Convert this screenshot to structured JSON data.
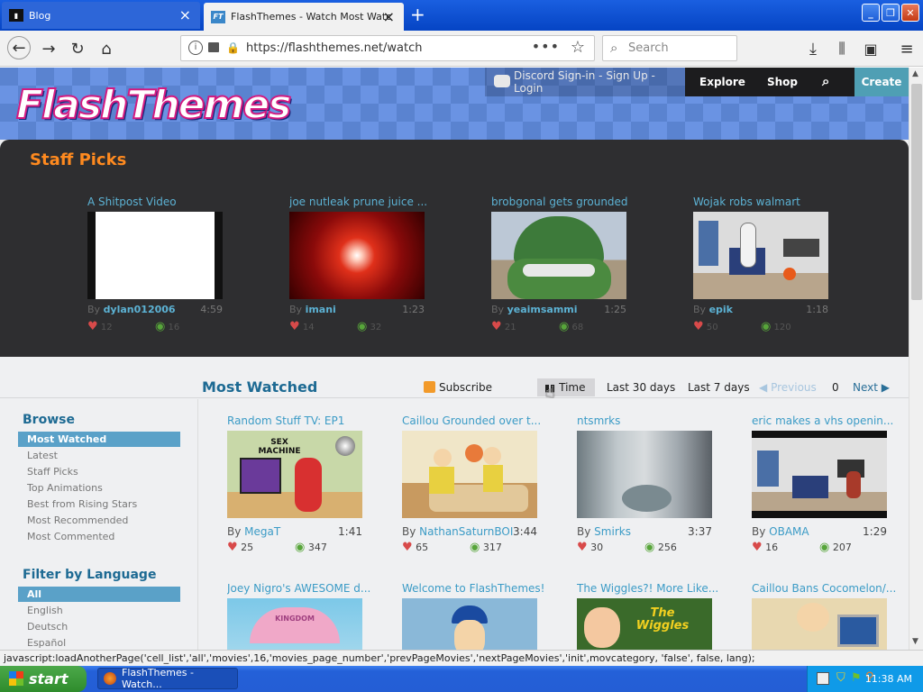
{
  "browser": {
    "tabs": [
      {
        "label": "Blog",
        "favicon": "blog-favicon"
      },
      {
        "label": "FlashThemes - Watch Most Watc",
        "favicon": "flashthemes-favicon"
      }
    ],
    "url": "https://flashthemes.net/watch",
    "search_placeholder": "Search"
  },
  "site": {
    "logo": "FlashThemes",
    "signin": "Discord Sign-in - Sign Up - Login",
    "nav": {
      "explore": "Explore",
      "shop": "Shop",
      "create": "Create"
    }
  },
  "staff_picks": {
    "title": "Staff Picks",
    "items": [
      {
        "title": "A Shitpost Video",
        "by": "By",
        "author": "dylan012006",
        "duration": "4:59",
        "likes": "12",
        "views": "16"
      },
      {
        "title": "joe nutleak prune juice ...",
        "by": "By",
        "author": "imani",
        "duration": "1:23",
        "likes": "14",
        "views": "32"
      },
      {
        "title": "brobgonal gets grounded",
        "by": "By",
        "author": "yeaimsammi",
        "duration": "1:25",
        "likes": "21",
        "views": "68"
      },
      {
        "title": "Wojak robs walmart",
        "by": "By",
        "author": "epik",
        "duration": "1:18",
        "likes": "50",
        "views": "120"
      }
    ]
  },
  "most_watched": {
    "title": "Most Watched",
    "subscribe": "Subscribe",
    "time_label": "Time",
    "last30": "Last 30 days",
    "last7": "Last 7 days",
    "previous": "Previous",
    "page": "0",
    "next": "Next",
    "videos": [
      {
        "title": "Random Stuff TV: EP1",
        "by": "By",
        "author": "MegaT",
        "duration": "1:41",
        "likes": "25",
        "views": "347"
      },
      {
        "title": "Caillou Grounded over t...",
        "by": "By",
        "author": "NathanSaturnBOI",
        "duration": "3:44",
        "likes": "65",
        "views": "317"
      },
      {
        "title": "ntsmrks",
        "by": "By",
        "author": "Smirks",
        "duration": "3:37",
        "likes": "30",
        "views": "256"
      },
      {
        "title": "eric makes a vhs openin...",
        "by": "By",
        "author": "OBAMA",
        "duration": "1:29",
        "likes": "16",
        "views": "207"
      },
      {
        "title": "Joey Nigro's AWESOME d...",
        "by": "",
        "author": "",
        "duration": "",
        "likes": "",
        "views": ""
      },
      {
        "title": "Welcome to FlashThemes!",
        "by": "",
        "author": "",
        "duration": "",
        "likes": "",
        "views": ""
      },
      {
        "title": "The Wiggles?! More Like...",
        "by": "",
        "author": "",
        "duration": "",
        "likes": "",
        "views": ""
      },
      {
        "title": "Caillou Bans Cocomelon/...",
        "by": "",
        "author": "",
        "duration": "",
        "likes": "",
        "views": ""
      }
    ]
  },
  "sidebar": {
    "browse_title": "Browse",
    "browse_items": [
      "Most Watched",
      "Latest",
      "Staff Picks",
      "Top Animations",
      "Best from Rising Stars",
      "Most Recommended",
      "Most Commented"
    ],
    "lang_title": "Filter by Language",
    "lang_items": [
      "All",
      "English",
      "Deutsch",
      "Español"
    ]
  },
  "thumbnail_text": {
    "sex_machine": "SEX\nMACHINE",
    "wiggles": "The Wiggles",
    "kingdom": "KINGDOM"
  },
  "status": "javascript:loadAnotherPage('cell_list','all','movies',16,'movies_page_number','prevPageMovies','nextPageMovies','init',movcategory, 'false', false, lang);",
  "taskbar": {
    "start": "start",
    "item": "FlashThemes - Watch...",
    "clock": "11:38 AM"
  },
  "colors": {
    "accent": "#1d6a93",
    "orange": "#ff8a1f",
    "create": "#4f9fb4",
    "link": "#3b9bc6"
  }
}
